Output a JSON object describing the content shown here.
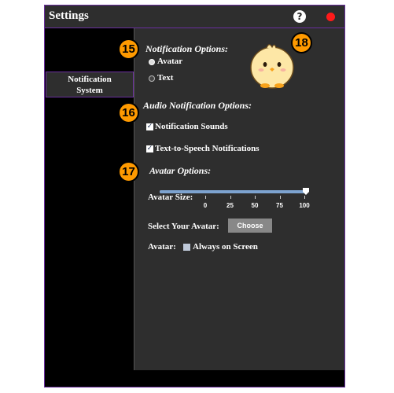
{
  "window": {
    "title": "Settings",
    "help_glyph": "?"
  },
  "sidebar": {
    "items": [
      {
        "label_line1": "Notification",
        "label_line2": "System"
      }
    ]
  },
  "notification": {
    "heading": "Notification Options:",
    "options": [
      {
        "label": "Avatar",
        "selected": true
      },
      {
        "label": "Text",
        "selected": false
      }
    ]
  },
  "audio": {
    "heading": "Audio Notification Options:",
    "sounds_label": "Notification Sounds",
    "sounds_checked": true,
    "tts_label": "Text-to-Speech Notifications",
    "tts_checked": true
  },
  "avatar": {
    "heading": "Avatar Options:",
    "size_label": "Avatar Size:",
    "size_value": 100,
    "size_ticks": [
      "0",
      "25",
      "50",
      "75",
      "100"
    ],
    "select_label": "Select Your Avatar:",
    "choose_label": "Choose",
    "always_prefix": "Avatar:",
    "always_label": "Always on Screen",
    "always_checked": false
  },
  "badges": [
    "15",
    "16",
    "17",
    "18"
  ],
  "colors": {
    "accent_border": "#6a2e9e",
    "panel_bg": "#2e2e2e",
    "badge": "#ff9a00",
    "close_dot": "#ff1a1a"
  },
  "icons": {
    "help": "help-icon",
    "close": "close-dot-icon",
    "avatar": "chick-avatar-icon"
  }
}
